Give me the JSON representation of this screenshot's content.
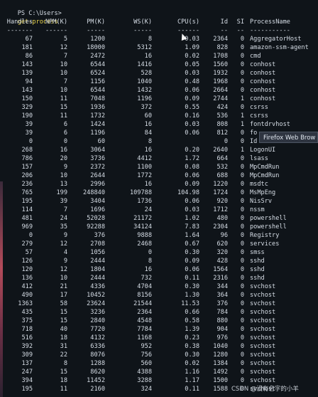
{
  "prompt": {
    "path": "PS C:\\Users>",
    "command": "get-process"
  },
  "headers": [
    "Handles",
    "NPM(K)",
    "PM(K)",
    "WS(K)",
    "CPU(s)",
    "Id",
    "SI",
    "ProcessName"
  ],
  "underlines": [
    "-------",
    "------",
    "-----",
    "-----",
    "------",
    "--",
    "--",
    "-----------"
  ],
  "rows": [
    [
      "67",
      "5",
      "1200",
      "8",
      "0.03",
      "2364",
      "0",
      "AggregatorHost"
    ],
    [
      "181",
      "12",
      "18000",
      "5312",
      "1.09",
      "828",
      "0",
      "amazon-ssm-agent"
    ],
    [
      "86",
      "7",
      "2472",
      "16",
      "0.02",
      "1708",
      "0",
      "cmd"
    ],
    [
      "143",
      "10",
      "6544",
      "1416",
      "0.05",
      "1560",
      "0",
      "conhost"
    ],
    [
      "139",
      "10",
      "6524",
      "528",
      "0.03",
      "1932",
      "0",
      "conhost"
    ],
    [
      "94",
      "7",
      "1156",
      "1040",
      "0.48",
      "1968",
      "0",
      "conhost"
    ],
    [
      "143",
      "10",
      "6544",
      "1432",
      "0.06",
      "2664",
      "0",
      "conhost"
    ],
    [
      "150",
      "11",
      "7048",
      "1196",
      "0.09",
      "2744",
      "1",
      "conhost"
    ],
    [
      "329",
      "15",
      "1936",
      "372",
      "0.55",
      "424",
      "0",
      "csrss"
    ],
    [
      "190",
      "11",
      "1732",
      "60",
      "0.16",
      "536",
      "1",
      "csrss"
    ],
    [
      "39",
      "6",
      "1424",
      "16",
      "0.03",
      "808",
      "1",
      "fontdrvhost"
    ],
    [
      "39",
      "6",
      "1196",
      "84",
      "0.06",
      "812",
      "0",
      "fo"
    ],
    [
      "0",
      "0",
      "60",
      "8",
      "",
      "0",
      "0",
      "Id"
    ],
    [
      "268",
      "16",
      "3064",
      "16",
      "0.20",
      "2640",
      "1",
      "LogonUI"
    ],
    [
      "786",
      "20",
      "3736",
      "4412",
      "1.72",
      "664",
      "0",
      "lsass"
    ],
    [
      "157",
      "9",
      "2372",
      "1100",
      "0.08",
      "532",
      "0",
      "MpCmdRun"
    ],
    [
      "206",
      "10",
      "2644",
      "1772",
      "0.06",
      "688",
      "0",
      "MpCmdRun"
    ],
    [
      "236",
      "13",
      "2996",
      "16",
      "0.09",
      "1220",
      "0",
      "msdtc"
    ],
    [
      "765",
      "199",
      "248840",
      "109788",
      "104.98",
      "1724",
      "0",
      "MsMpEng"
    ],
    [
      "195",
      "39",
      "3404",
      "1736",
      "0.06",
      "920",
      "0",
      "NisSrv"
    ],
    [
      "114",
      "7",
      "1696",
      "24",
      "0.03",
      "1712",
      "0",
      "nssm"
    ],
    [
      "481",
      "24",
      "52028",
      "21172",
      "1.02",
      "480",
      "0",
      "powershell"
    ],
    [
      "969",
      "35",
      "92288",
      "34124",
      "7.83",
      "2304",
      "0",
      "powershell"
    ],
    [
      "0",
      "9",
      "376",
      "9888",
      "1.64",
      "96",
      "0",
      "Registry"
    ],
    [
      "279",
      "12",
      "2708",
      "2468",
      "0.67",
      "620",
      "0",
      "services"
    ],
    [
      "57",
      "4",
      "1056",
      "0",
      "0.30",
      "320",
      "0",
      "smss"
    ],
    [
      "126",
      "9",
      "2444",
      "8",
      "0.09",
      "428",
      "0",
      "sshd"
    ],
    [
      "120",
      "12",
      "1804",
      "16",
      "0.06",
      "1564",
      "0",
      "sshd"
    ],
    [
      "136",
      "10",
      "2444",
      "732",
      "0.11",
      "2316",
      "0",
      "sshd"
    ],
    [
      "412",
      "21",
      "4336",
      "4704",
      "0.30",
      "344",
      "0",
      "svchost"
    ],
    [
      "490",
      "17",
      "10452",
      "8156",
      "1.30",
      "364",
      "0",
      "svchost"
    ],
    [
      "1363",
      "58",
      "23624",
      "21544",
      "11.53",
      "376",
      "0",
      "svchost"
    ],
    [
      "435",
      "15",
      "3236",
      "2364",
      "0.66",
      "784",
      "0",
      "svchost"
    ],
    [
      "375",
      "15",
      "2840",
      "4548",
      "0.58",
      "880",
      "0",
      "svchost"
    ],
    [
      "718",
      "40",
      "7720",
      "7784",
      "1.39",
      "904",
      "0",
      "svchost"
    ],
    [
      "516",
      "18",
      "4132",
      "1168",
      "0.23",
      "976",
      "0",
      "svchost"
    ],
    [
      "392",
      "31",
      "6336",
      "952",
      "0.38",
      "1040",
      "0",
      "svchost"
    ],
    [
      "309",
      "22",
      "8076",
      "756",
      "0.30",
      "1280",
      "0",
      "svchost"
    ],
    [
      "137",
      "8",
      "1288",
      "560",
      "0.02",
      "1384",
      "0",
      "svchost"
    ],
    [
      "247",
      "15",
      "8620",
      "4388",
      "1.16",
      "1492",
      "0",
      "svchost"
    ],
    [
      "394",
      "18",
      "11452",
      "3288",
      "1.17",
      "1500",
      "0",
      "svchost"
    ],
    [
      "195",
      "11",
      "2160",
      "324",
      "0.11",
      "1588",
      "0",
      "svchost"
    ]
  ],
  "tooltip": "Firefox Web Brow",
  "watermark": "CSDN @没有名字的小羊",
  "colors": {
    "background": "#0f1419",
    "text": "#d6dde6",
    "command": "#e8d44d"
  }
}
